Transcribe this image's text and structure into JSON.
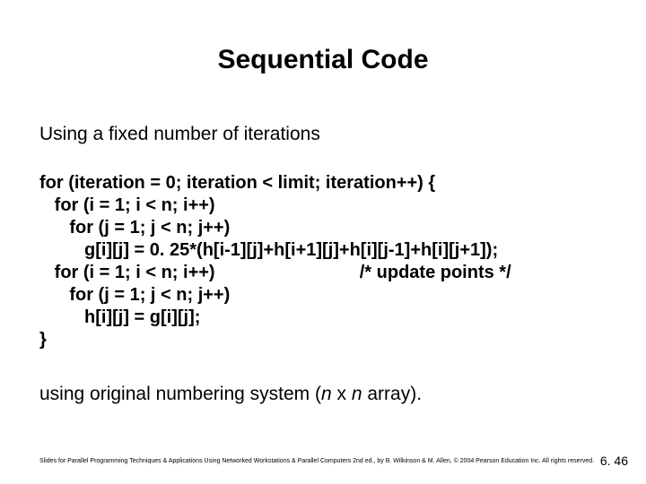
{
  "title": "Sequential Code",
  "subtitle": "Using a fixed number of iterations",
  "code": "for (iteration = 0; iteration < limit; iteration++) {\n   for (i = 1; i < n; i++)\n      for (j = 1; j < n; j++)\n         g[i][j] = 0. 25*(h[i-1][j]+h[i+1][j]+h[i][j-1]+h[i][j+1]);\n   for (i = 1; i < n; i++)                             /* update points */\n      for (j = 1; j < n; j++)\n         h[i][j] = g[i][j];\n}",
  "explain_prefix": "using original numbering system (",
  "explain_var1": "n",
  "explain_middle": " x ",
  "explain_var2": "n",
  "explain_suffix": " array).",
  "footer": "Slides for Parallel Programming Techniques & Applications Using Networked Workstations & Parallel Computers 2nd ed., by B. Wilkinson & M. Allen, © 2004 Pearson Education Inc. All rights reserved.",
  "pagenum": "6. 46"
}
